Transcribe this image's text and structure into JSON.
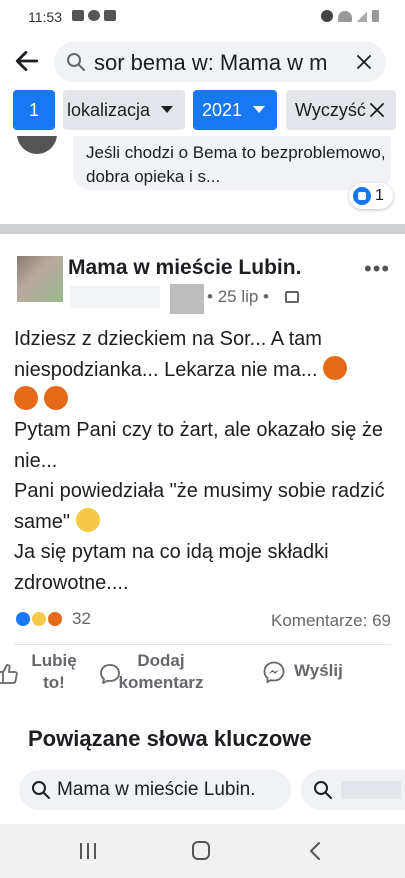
{
  "status_bar": {
    "time": "11:53"
  },
  "search": {
    "query": "sor bema w: Mama w m"
  },
  "filters": {
    "count": "1",
    "location_label": "lokalizacja",
    "year_label": "2021",
    "clear_label": "Wyczyść"
  },
  "previous_comment": {
    "text": "Jeśli chodzi o Bema to bezproblemowo, dobra opieka i s...",
    "reaction_count": "1"
  },
  "post": {
    "author": "Mama w mieście Lubin.",
    "date": "25 lip",
    "body_line1": "Idziesz z dzieckiem na Sor... A tam niespodzianka... Lekarza nie ma...",
    "body_line2": "Pytam Pani czy to żart, ale okazało się że nie...",
    "body_line3": "Pani powiedziała \"że musimy sobie radzić same\"",
    "body_line4": "Ja się pytam na co idą moje składki zdrowotne....",
    "reaction_count": "32",
    "comments_label": "Komentarze: 69",
    "actions": {
      "like": "Lubię to!",
      "comment": "Dodaj komentarz",
      "share": "Wyślij"
    }
  },
  "related": {
    "title": "Powiązane słowa kluczowe",
    "keywords": [
      "Mama w mieście Lubin."
    ]
  },
  "colors": {
    "accent": "#1877f2",
    "chip_gray": "#e4e6eb",
    "text_secondary": "#65676b"
  }
}
